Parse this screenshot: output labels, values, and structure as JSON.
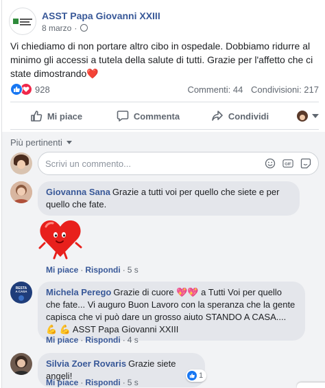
{
  "post": {
    "page_name": "ASST Papa Giovanni XXIII",
    "date": "8 marzo",
    "meta_sep": "·",
    "text": "Vi chiediamo di non portare altro cibo in ospedale. Dobbiamo ridurre al minimo gli accessi a tutela della salute di tutti. Grazie per l'affetto che ci state dimostrando",
    "text_emoji": "❤️",
    "reaction_count": "928",
    "comments_count": "Commenti: 44",
    "shares_count": "Condivisioni: 217"
  },
  "actions": {
    "like": "Mi piace",
    "comment": "Commenta",
    "share": "Condividi"
  },
  "comments_section": {
    "sort_label": "Più pertinenti",
    "composer_placeholder": "Scrivi un commento...",
    "composer_icons": [
      "emoji-icon",
      "gif-icon",
      "sticker-icon"
    ],
    "items": [
      {
        "author": "Giovanna Sana",
        "text": "Grazie a tutti voi per quello che siete e per quello che fate.",
        "sticker": "heart-character-sticker",
        "like_label": "Mi piace",
        "reply_label": "Rispondi",
        "sep": "·",
        "time": "5 s"
      },
      {
        "author": "Michela Perego",
        "text_a": "Grazie di cuore",
        "hearts": "💖💖",
        "text_b": "a Tutti Voi per quello che fate... Vi auguro Buon Lavoro con la speranza che la gente capisca che vi può dare un grosso aiuto STANDO A CASA....",
        "muscle": "💪",
        "mention": "ASST Papa Giovanni XXIII",
        "like_label": "Mi piace",
        "reply_label": "Rispondi",
        "sep": "·",
        "time": "4 s"
      },
      {
        "author": "Silvia Zoer Rovaris",
        "text": "Grazie siete angeli!",
        "like_label": "Mi piace",
        "reply_label": "Rispondi",
        "sep": "·",
        "time": "5 s",
        "reaction_count": "1"
      }
    ]
  },
  "colors": {
    "link": "#385898",
    "like_blue": "#1877f2",
    "love_red": "#f0284a",
    "comment_bg": "#f2f3f5"
  }
}
